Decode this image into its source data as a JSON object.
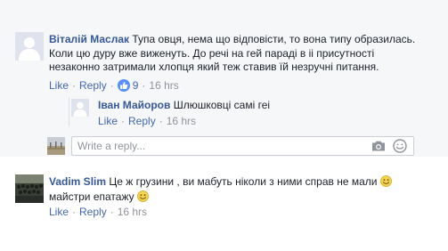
{
  "comments": [
    {
      "author": "Віталій Маслак",
      "text_line1": "Тупа овця, нема що відповісти, то вона типу образилась.",
      "text_line2": "Коли цю дуру вже виженуть. До речі на гей параді в іі присутності",
      "text_line3": "незаконно затримали хлопця який теж ставив їй незручні питання.",
      "like_label": "Like",
      "reply_label": "Reply",
      "reaction_count": "9",
      "time": "16 hrs"
    },
    {
      "author": "Іван Майоров",
      "text": "Шлюшковці самі геі",
      "like_label": "Like",
      "reply_label": "Reply",
      "time": "16 hrs"
    },
    {
      "author": "Vadim Slim",
      "text_line1": "Це ж грузини , ви мабуть ніколи з ними справ не мали",
      "text_line2": "майстри епатажу",
      "like_label": "Like",
      "reply_label": "Reply",
      "time": "16 hrs"
    }
  ],
  "reply_box": {
    "placeholder": "Write a reply..."
  },
  "icons": {
    "reaction": "like-icon",
    "camera": "camera-icon",
    "emoji": "smiley-icon"
  },
  "colors": {
    "author": "#365899",
    "link": "#4267b2",
    "muted": "#90949c",
    "reaction_bg": "#5890ff",
    "thread_bg": "#f6f7f9"
  }
}
